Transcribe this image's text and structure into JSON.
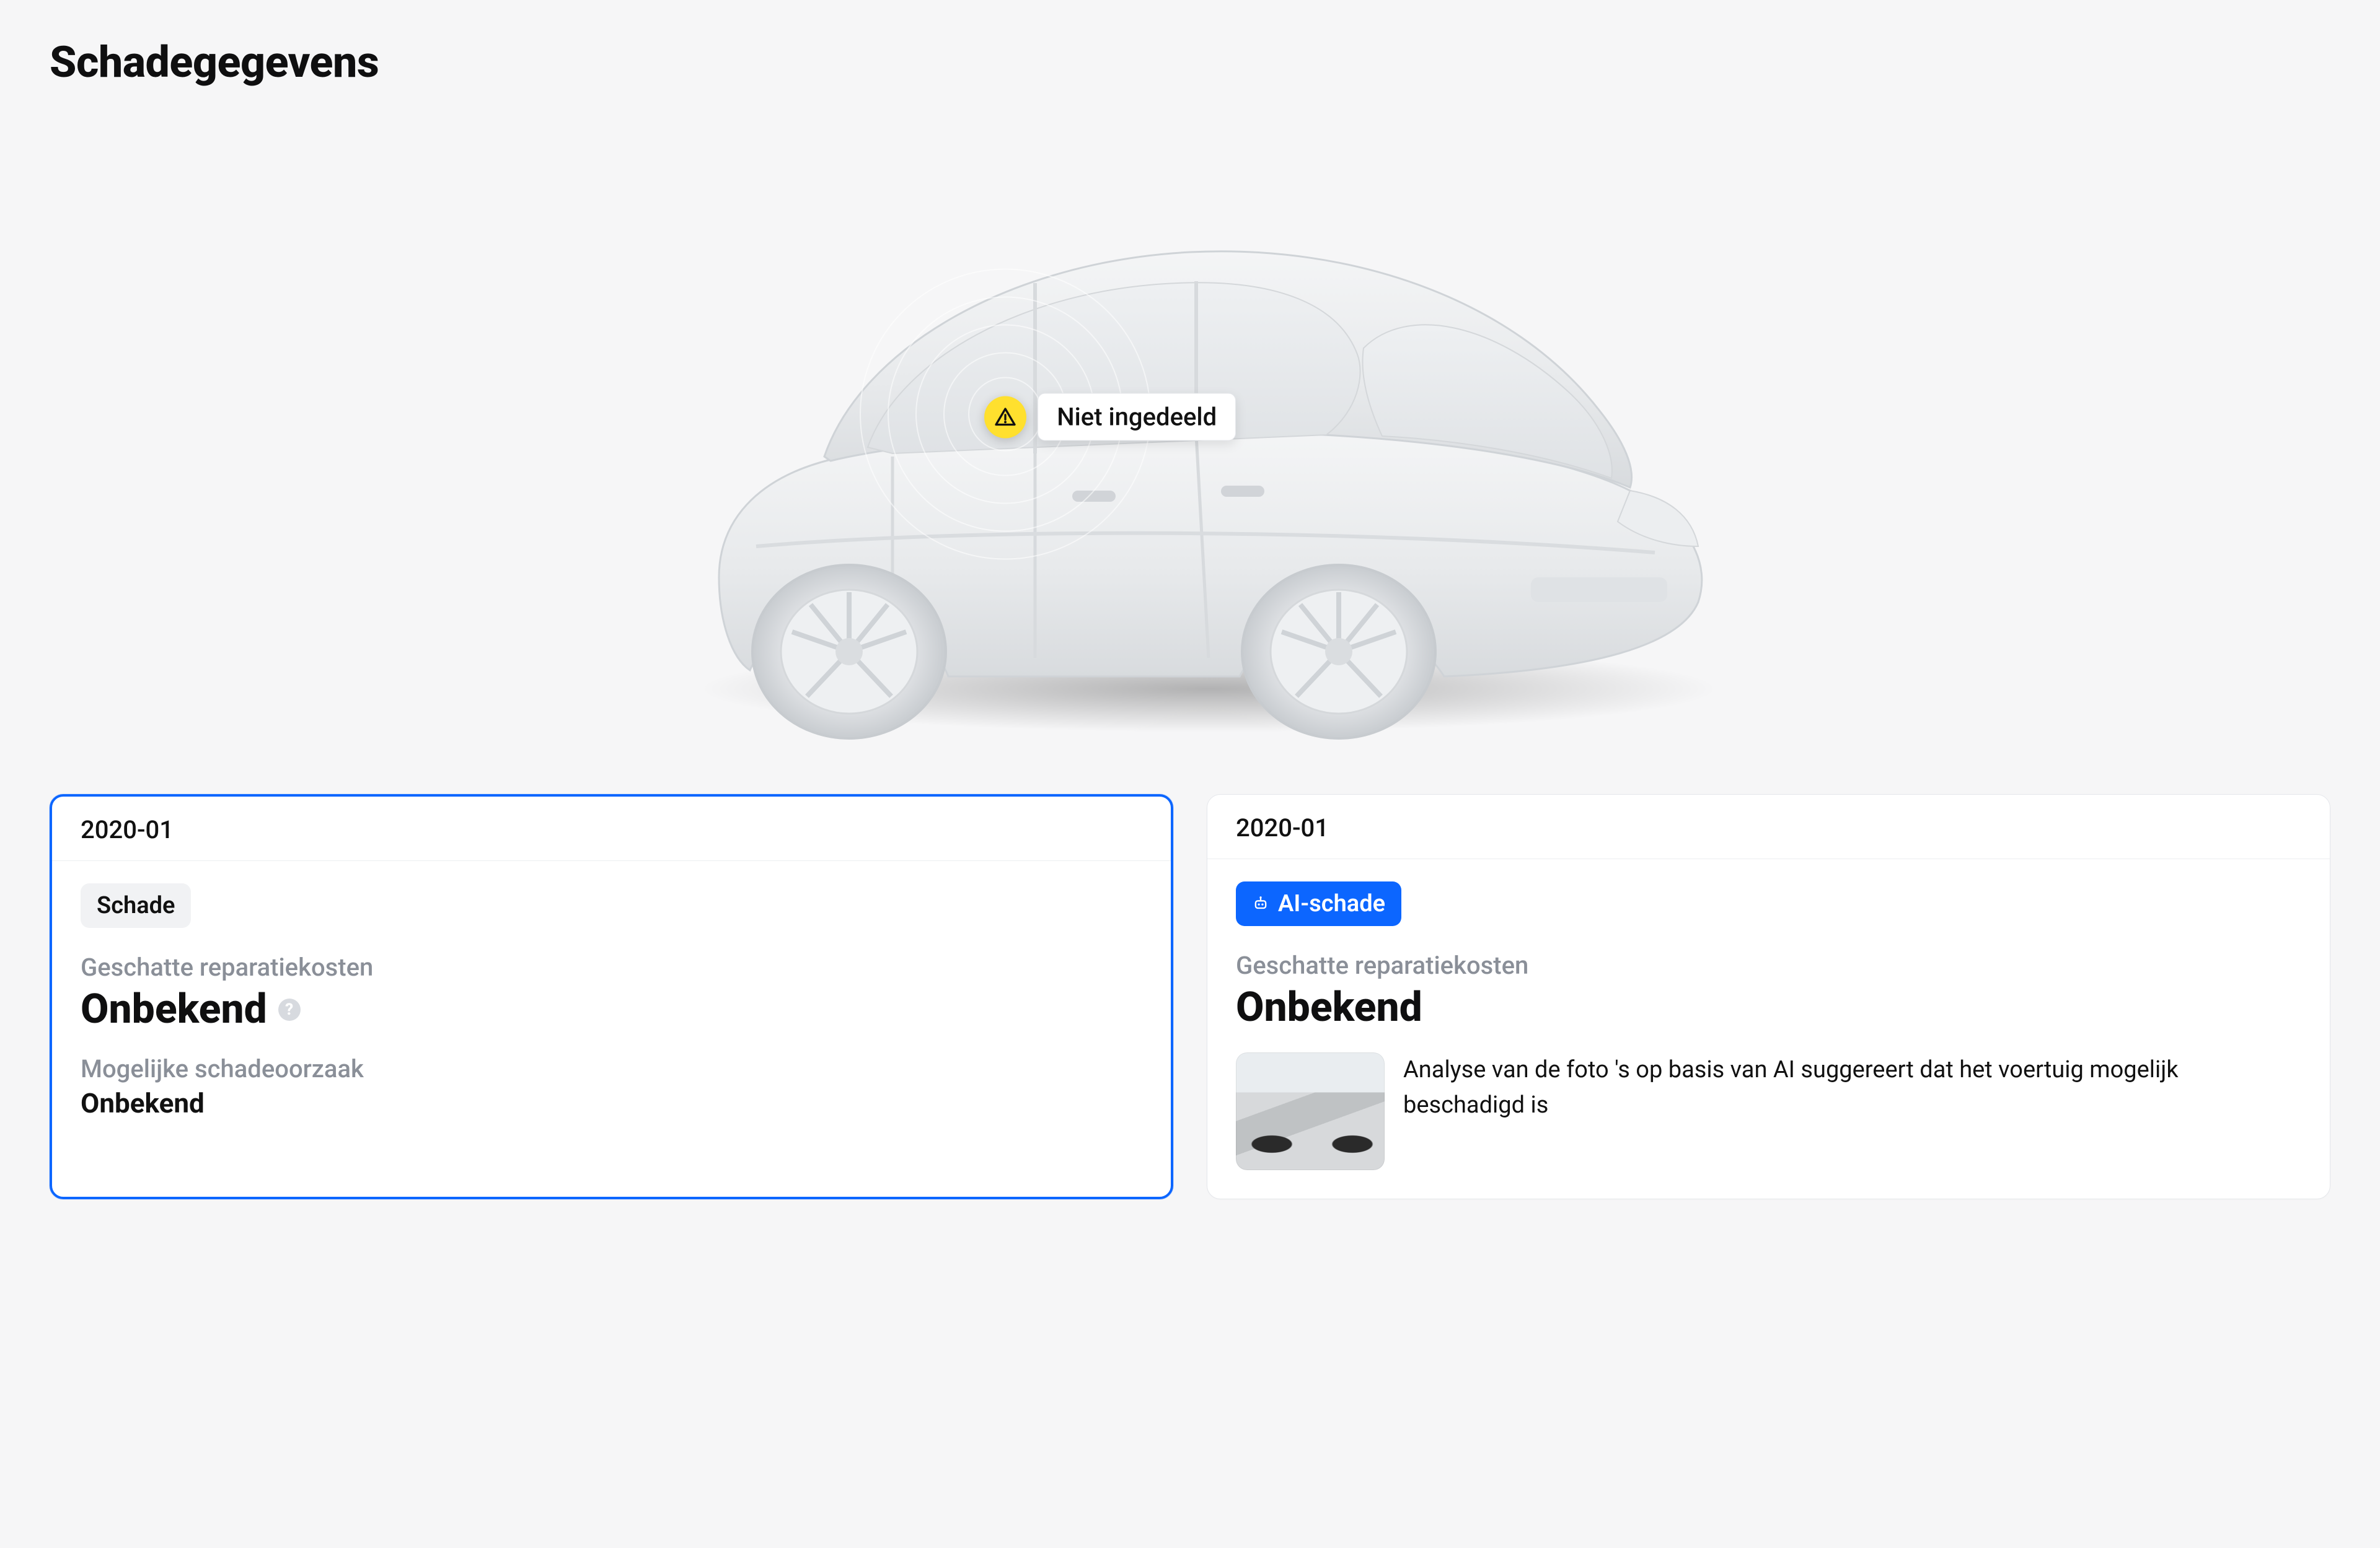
{
  "page": {
    "title": "Schadegegevens"
  },
  "hotspot": {
    "label": "Niet ingedeeld",
    "icon": "warning-triangle-icon"
  },
  "cards": [
    {
      "date": "2020-01",
      "chip": {
        "label": "Schade",
        "kind": "plain"
      },
      "est_label": "Geschatte reparatiekosten",
      "est_value": "Onbekend",
      "has_help": true,
      "cause_label": "Mogelijke schadeoorzaak",
      "cause_value": "Onbekend",
      "selected": true
    },
    {
      "date": "2020-01",
      "chip": {
        "label": "AI-schade",
        "kind": "blue",
        "icon": "robot-icon"
      },
      "est_label": "Geschatte reparatiekosten",
      "est_value": "Onbekend",
      "ai_text": "Analyse van de foto 's op basis van AI suggereert dat het voertuig mogelijk beschadigd is",
      "selected": false
    }
  ]
}
